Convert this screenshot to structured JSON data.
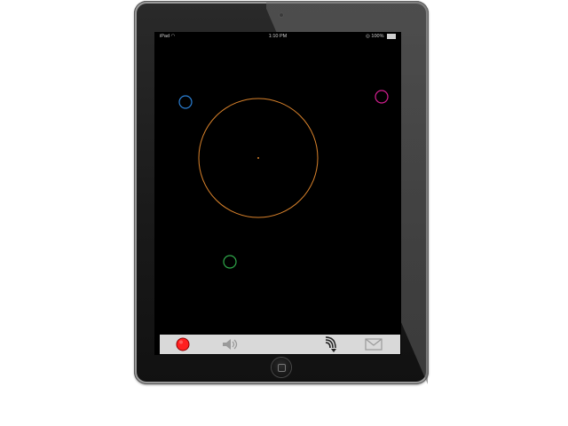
{
  "device": {
    "type": "iPad",
    "status_bar": {
      "carrier": "iPad",
      "time": "1:10 PM",
      "battery": "100%"
    }
  },
  "colors": {
    "big_circle": "#d9822b",
    "blue_circle": "#2a7fd4",
    "magenta_circle": "#d31e8f",
    "green_circle": "#2fa84a",
    "record": "#ff2020",
    "toolbar_bg": "#d9d9d9"
  },
  "toolbar": {
    "buttons": [
      {
        "name": "record",
        "icon": "record-icon"
      },
      {
        "name": "sound",
        "icon": "speaker-icon"
      },
      {
        "name": "feedback",
        "icon": "handover-icon"
      },
      {
        "name": "email",
        "icon": "mail-icon"
      }
    ]
  }
}
